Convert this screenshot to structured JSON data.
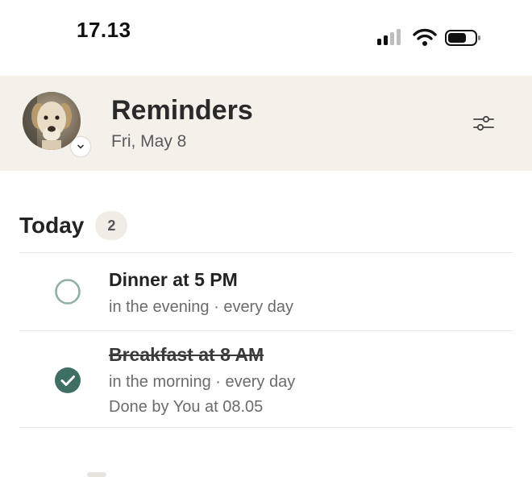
{
  "status_bar": {
    "time": "17.13",
    "icons": [
      "signal-icon",
      "wifi-icon",
      "battery-icon"
    ]
  },
  "header": {
    "title": "Reminders",
    "date": "Fri, May 8",
    "avatar": "dog-avatar",
    "filter_icon": "sliders-icon"
  },
  "section": {
    "title": "Today",
    "count": "2"
  },
  "reminders": [
    {
      "title": "Dinner at 5 PM",
      "meta": "in the evening · every day",
      "done": false
    },
    {
      "title": "Breakfast at 8 AM",
      "meta": "in the morning · every day",
      "done_by": "Done by You at 08.05",
      "done": true
    }
  ],
  "colors": {
    "header_bg": "#f3f1ea",
    "accent": "#3d6f62",
    "badge_bg": "#efede6"
  }
}
